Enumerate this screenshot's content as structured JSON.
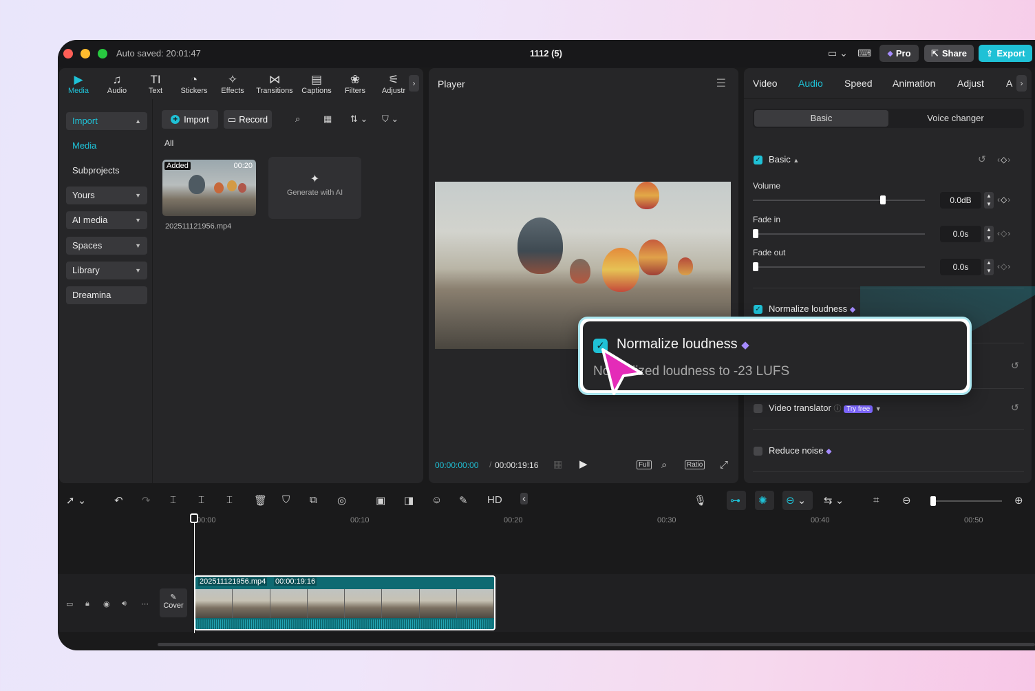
{
  "titlebar": {
    "autosaved": "Auto saved: 20:01:47",
    "project_title": "1112 (5)",
    "pro_label": "Pro",
    "share_label": "Share",
    "export_label": "Export"
  },
  "colors": {
    "accent": "#1fc1d6",
    "pro_purple": "#7d67ff",
    "traffic_red": "#fe5f57",
    "traffic_yellow": "#febc2e",
    "traffic_green": "#28c840"
  },
  "tool_tabs": [
    {
      "label": "Media",
      "icon": "media-icon",
      "glyph": "▶"
    },
    {
      "label": "Audio",
      "icon": "audio-icon",
      "glyph": "♫"
    },
    {
      "label": "Text",
      "icon": "text-icon",
      "glyph": "TI"
    },
    {
      "label": "Stickers",
      "icon": "stickers-icon",
      "glyph": "◔"
    },
    {
      "label": "Effects",
      "icon": "effects-icon",
      "glyph": "✧"
    },
    {
      "label": "Transitions",
      "icon": "transitions-icon",
      "glyph": "⋈"
    },
    {
      "label": "Captions",
      "icon": "captions-icon",
      "glyph": "▤"
    },
    {
      "label": "Filters",
      "icon": "filters-icon",
      "glyph": "❀"
    },
    {
      "label": "Adjustr",
      "icon": "adjust-icon",
      "glyph": "⚟"
    }
  ],
  "side_nav": {
    "import": "Import",
    "media": "Media",
    "subprojects": "Subprojects",
    "yours": "Yours",
    "ai_media": "AI media",
    "spaces": "Spaces",
    "library": "Library",
    "dreamina": "Dreamina"
  },
  "media": {
    "import_label": "Import",
    "record_label": "Record",
    "all_label": "All",
    "thumb_added": "Added",
    "thumb_duration": "00:20",
    "thumb_name": "202511121956.mp4",
    "generate_ai": "Generate with AI"
  },
  "player": {
    "title": "Player",
    "current_time": "00:00:00:00",
    "total_time": "00:00:19:16",
    "full_label": "Full",
    "ratio_label": "Ratio"
  },
  "right_panel": {
    "tabs": [
      "Video",
      "Audio",
      "Speed",
      "Animation",
      "Adjust",
      "A"
    ],
    "active_tab": "Audio",
    "seg_basic": "Basic",
    "seg_voice": "Voice changer",
    "section_basic": "Basic",
    "volume_label": "Volume",
    "volume_value": "0.0dB",
    "volume_level": 0.74,
    "fadein_label": "Fade in",
    "fadein_value": "0.0s",
    "fadeout_label": "Fade out",
    "fadeout_value": "0.0s",
    "normalize_label": "Normalize loudness",
    "video_translator_label": "Video translator",
    "try_free": "Try free",
    "reduce_noise_label": "Reduce noise"
  },
  "timeline": {
    "ticks": [
      "00:00",
      "00:10",
      "00:20",
      "00:30",
      "00:40",
      "00:50"
    ],
    "cover_label": "Cover",
    "clip_name": "202511121956.mp4",
    "clip_duration": "00:00:19:16"
  },
  "callout": {
    "title": "Normalize loudness",
    "description": "Normalized loudness to -23 LUFS"
  }
}
